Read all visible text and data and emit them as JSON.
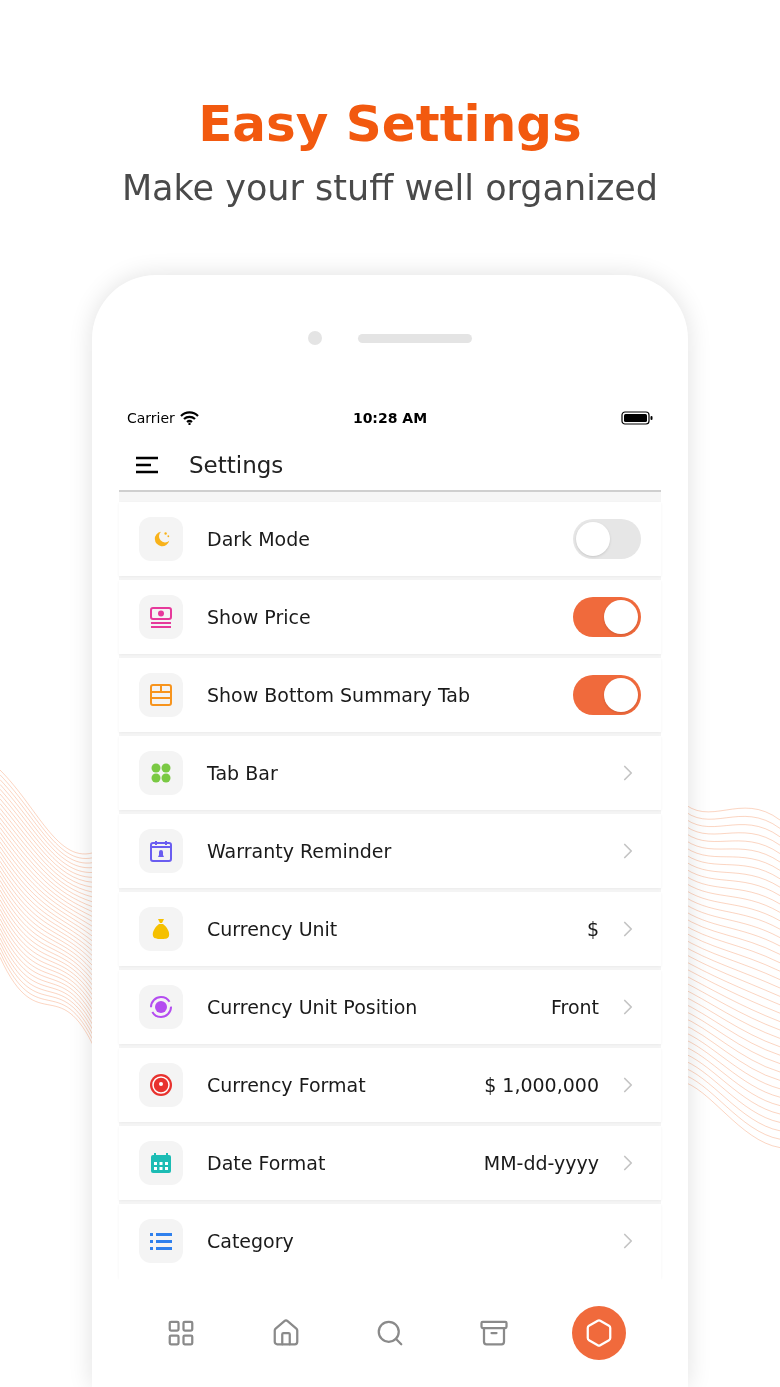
{
  "headline": "Easy Settings",
  "subtitle": "Make your stuff well organized",
  "status_bar": {
    "carrier": "Carrier",
    "time": "10:28 AM"
  },
  "header": {
    "title": "Settings"
  },
  "settings": [
    {
      "kind": "toggle",
      "label": "Dark Mode",
      "on": false
    },
    {
      "kind": "toggle",
      "label": "Show Price",
      "on": true
    },
    {
      "kind": "toggle",
      "label": "Show Bottom Summary Tab",
      "on": true
    },
    {
      "kind": "link",
      "label": "Tab Bar"
    },
    {
      "kind": "link",
      "label": "Warranty Reminder"
    },
    {
      "kind": "link",
      "label": "Currency Unit",
      "value": "$"
    },
    {
      "kind": "link",
      "label": "Currency Unit Position",
      "value": "Front"
    },
    {
      "kind": "link",
      "label": "Currency Format",
      "value": "$ 1,000,000"
    },
    {
      "kind": "link",
      "label": "Date Format",
      "value": "MM-dd-yyyy"
    },
    {
      "kind": "link",
      "label": "Category"
    }
  ],
  "tab_bar": [
    {
      "kind": "grid",
      "selected": false
    },
    {
      "kind": "home",
      "selected": false
    },
    {
      "kind": "search",
      "selected": false
    },
    {
      "kind": "archive",
      "selected": false
    },
    {
      "kind": "settings",
      "selected": true
    }
  ]
}
